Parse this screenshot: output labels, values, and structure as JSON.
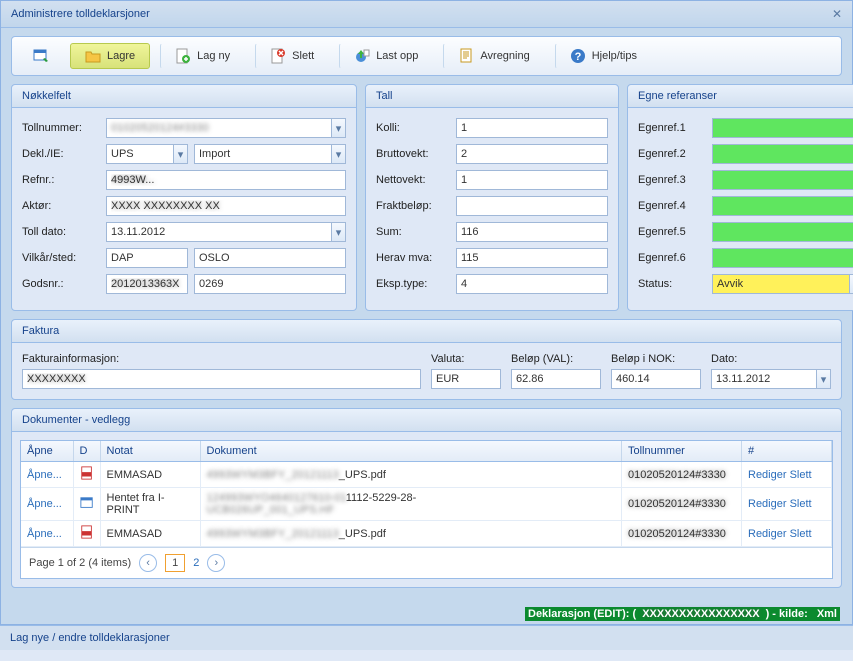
{
  "title": "Administrere tolldeklarsjoner",
  "toolbar": {
    "lagre": "Lagre",
    "lagny": "Lag ny",
    "slett": "Slett",
    "lastopp": "Last opp",
    "avregning": "Avregning",
    "hjelp": "Hjelp/tips"
  },
  "nokkelfelt": {
    "title": "Nøkkelfelt",
    "labels": {
      "tollnummer": "Tollnummer:",
      "deklie": "Dekl./IE:",
      "refnr": "Refnr.:",
      "aktor": "Aktør:",
      "tolldato": "Toll dato:",
      "vilkarsted": "Vilkår/sted:",
      "godsnr": "Godsnr.:"
    },
    "values": {
      "tollnummer": "01020520124#3330",
      "dekl": "UPS",
      "ie": "Import",
      "refnr": "4993W...",
      "aktor": "XXXX XXXXXXXX XX",
      "tolldato": "13.11.2012",
      "vilkar": "DAP",
      "sted": "OSLO",
      "gods1": "2012013363X",
      "gods2": "0269"
    }
  },
  "tall": {
    "title": "Tall",
    "labels": {
      "kolli": "Kolli:",
      "bruttovekt": "Bruttovekt:",
      "nettovekt": "Nettovekt:",
      "fraktbelop": "Fraktbeløp:",
      "sum": "Sum:",
      "heravmva": "Herav mva:",
      "eksptype": "Eksp.type:"
    },
    "values": {
      "kolli": "1",
      "bruttovekt": "2",
      "nettovekt": "1",
      "fraktbelop": "",
      "sum": "116",
      "heravmva": "115",
      "eksptype": "4"
    }
  },
  "egne": {
    "title": "Egne referanser",
    "labels": {
      "r1": "Egenref.1",
      "r2": "Egenref.2",
      "r3": "Egenref.3",
      "r4": "Egenref.4",
      "r5": "Egenref.5",
      "r6": "Egenref.6",
      "status": "Status:"
    },
    "status": "Avvik"
  },
  "faktura": {
    "title": "Faktura",
    "labels": {
      "info": "Fakturainformasjon:",
      "valuta": "Valuta:",
      "belopval": "Beløp (VAL):",
      "belopnok": "Beløp i NOK:",
      "dato": "Dato:"
    },
    "values": {
      "info": "XXXXXXXX",
      "valuta": "EUR",
      "belopval": "62.86",
      "belopnok": "460.14",
      "dato": "13.11.2012"
    }
  },
  "dok": {
    "title": "Dokumenter - vedlegg",
    "headers": {
      "apne": "Åpne",
      "d": "D",
      "notat": "Notat",
      "dokument": "Dokument",
      "tollnummer": "Tollnummer",
      "hash": "#"
    },
    "rows": [
      {
        "apne": "Åpne...",
        "notat": "EMMASAD",
        "dokument_a": "4993WYM3BFY_20121113",
        "dokument_b": "_UPS.pdf",
        "tollnummer": "01020520124#3330",
        "rediger": "Rediger",
        "slett": "Slett"
      },
      {
        "apne": "Åpne...",
        "notat": "Hentet fra I-PRINT",
        "dokument_a": "124993WYO4640127610-01",
        "dokument_b": "1112-5229-28-",
        "dokument_c": "UCB026UP_001_UPS.HF",
        "tollnummer": "01020520124#3330",
        "rediger": "Rediger",
        "slett": "Slett"
      },
      {
        "apne": "Åpne...",
        "notat": "EMMASAD",
        "dokument_a": "4993WYM3BFY_20121113",
        "dokument_b": "_UPS.pdf",
        "tollnummer": "01020520124#3330",
        "rediger": "Rediger",
        "slett": "Slett"
      }
    ],
    "pager": {
      "text": "Page 1 of 2 (4 items)",
      "p1": "1",
      "p2": "2"
    }
  },
  "statusbar": {
    "a": "Deklarasjon (EDIT): (",
    "b": "XXXXXXXXXXXXXXXX",
    "c": ") - kilde: ",
    "d": "Xml"
  },
  "footer": "Lag nye / endre tolldeklarasjoner"
}
